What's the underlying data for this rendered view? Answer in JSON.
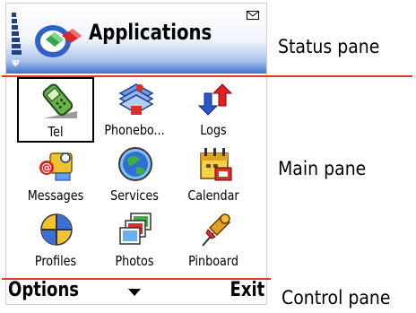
{
  "status_pane": {
    "title": "Applications",
    "antenna_symbol": "Ψ"
  },
  "main_pane": {
    "items": [
      {
        "label": "Tel",
        "icon": "phone-icon",
        "selected": true
      },
      {
        "label": "Phonebo...",
        "icon": "phonebook-icon",
        "selected": false
      },
      {
        "label": "Logs",
        "icon": "logs-icon",
        "selected": false
      },
      {
        "label": "Messages",
        "icon": "messages-icon",
        "selected": false
      },
      {
        "label": "Services",
        "icon": "globe-icon",
        "selected": false
      },
      {
        "label": "Calendar",
        "icon": "calendar-icon",
        "selected": false
      },
      {
        "label": "Profiles",
        "icon": "profiles-icon",
        "selected": false
      },
      {
        "label": "Photos",
        "icon": "photos-icon",
        "selected": false
      },
      {
        "label": "Pinboard",
        "icon": "pushpin-icon",
        "selected": false
      }
    ]
  },
  "control_pane": {
    "left_softkey": "Options",
    "right_softkey": "Exit"
  },
  "annotations": {
    "status": "Status pane",
    "main": "Main pane",
    "control": "Control pane"
  },
  "colors": {
    "accent_blue": "#3d72cf",
    "separator_red": "#e03a2c"
  }
}
